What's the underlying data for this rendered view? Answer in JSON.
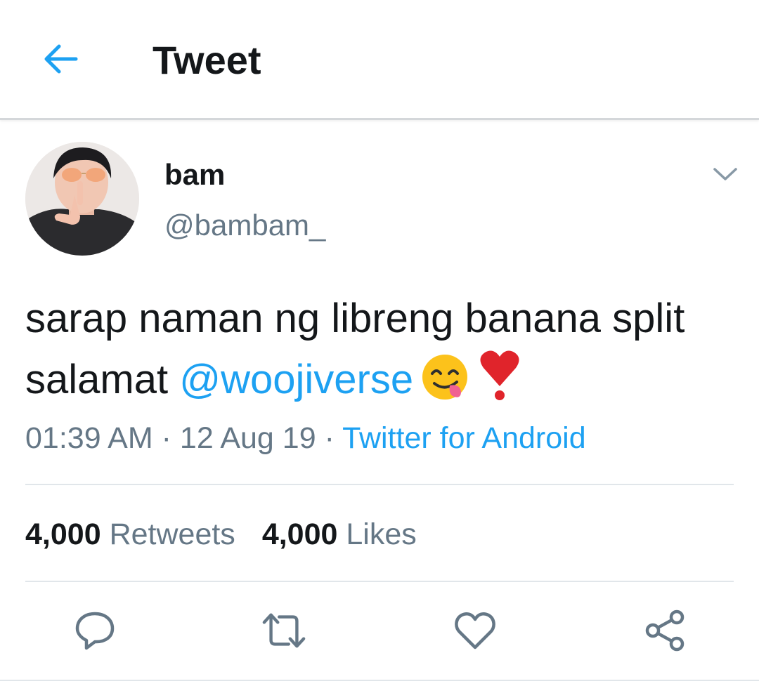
{
  "header": {
    "title": "Tweet",
    "back_icon": "arrow-left-icon",
    "accent": "#1da1f2"
  },
  "tweet": {
    "author": {
      "display_name": "bam",
      "handle": "@bambam_"
    },
    "text_part1": "sarap naman ng libreng banana split salamat ",
    "mention": "@woojiverse",
    "emojis": [
      "yum-face-emoji",
      "heavy-heart-exclamation-emoji"
    ],
    "time": "01:39 AM",
    "sep": "·",
    "date": "12 Aug 19",
    "source": "Twitter for Android"
  },
  "stats": {
    "retweets_count": "4,000",
    "retweets_label": "Retweets",
    "likes_count": "4,000",
    "likes_label": "Likes"
  },
  "actions": [
    "reply-icon",
    "retweet-icon",
    "like-icon",
    "share-icon"
  ],
  "colors": {
    "text": "#14171a",
    "secondary": "#657786",
    "link": "#1da1f2",
    "divider": "#e1e6ea"
  }
}
